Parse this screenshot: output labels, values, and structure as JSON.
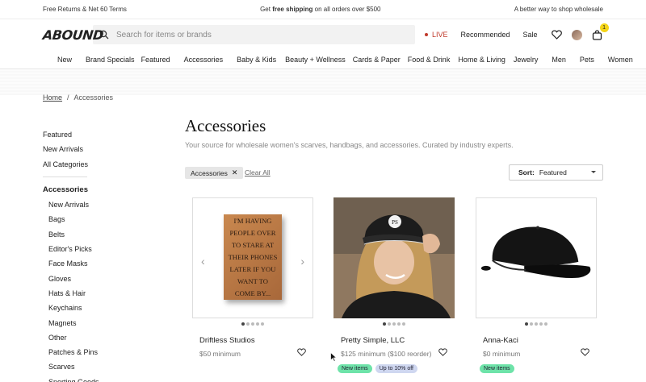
{
  "topbar": {
    "left": "Free Returns & Net 60 Terms",
    "center_pre": "Get ",
    "center_bold": "free shipping",
    "center_post": " on all orders over $500",
    "right": "A better way to shop wholesale"
  },
  "header": {
    "logo": "ABOUND",
    "search_placeholder": "Search for items or brands",
    "live": "LIVE",
    "recommended": "Recommended",
    "sale": "Sale",
    "cart_count": "1"
  },
  "catnav": [
    "New",
    "Brand Specials",
    "Featured",
    "Accessories",
    "Baby & Kids",
    "Beauty + Wellness",
    "Cards & Paper",
    "Food & Drink",
    "Home & Living",
    "Jewelry",
    "Men",
    "Pets",
    "Women"
  ],
  "breadcrumb": {
    "home": "Home",
    "sep": "/",
    "current": "Accessories"
  },
  "sidebar": {
    "top": [
      "Featured",
      "New Arrivals",
      "All Categories"
    ],
    "heading": "Accessories",
    "sub": [
      "New Arrivals",
      "Bags",
      "Belts",
      "Editor's Picks",
      "Face Masks",
      "Gloves",
      "Hats & Hair",
      "Keychains",
      "Magnets",
      "Other",
      "Patches & Pins",
      "Scarves",
      "Sporting Goods"
    ]
  },
  "main": {
    "title": "Accessories",
    "description": "Your source for wholesale women's scarves, handbags, and accessories. Curated by industry experts.",
    "filter_chip": "Accessories",
    "clear_all": "Clear All",
    "sort_label": "Sort:",
    "sort_value": "Featured"
  },
  "products": [
    {
      "name": "Driftless Studios",
      "minimum": "$50 minimum",
      "badges": [],
      "magnet_text": "I'M HAVING PEOPLE OVER TO STARE AT THEIR PHONES LATER IF YOU WANT TO COME BY..."
    },
    {
      "name": "Pretty Simple, LLC",
      "minimum": "$125 minimum ($100 reorder)",
      "badges": [
        "New items",
        "Up to 10% off"
      ],
      "cap_logo": "PS"
    },
    {
      "name": "Anna-Kaci",
      "minimum": "$0 minimum",
      "badges": [
        "New items"
      ]
    }
  ],
  "colors": {
    "live": "#c0392b",
    "badge_new": "#6ee3a9",
    "badge_off": "#cfd7f0",
    "cart_badge": "#f5d518"
  }
}
